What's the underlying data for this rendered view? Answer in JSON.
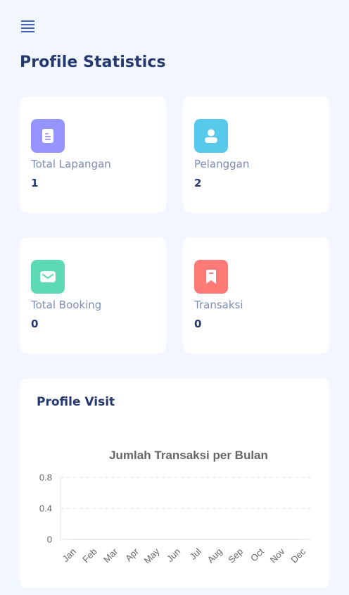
{
  "header": {
    "menu_icon": "hamburger-menu-icon",
    "title": "Profile Statistics"
  },
  "stats": [
    {
      "label": "Total Lapangan",
      "value": "1",
      "icon": "document-icon",
      "color": "#9694ff"
    },
    {
      "label": "Pelanggan",
      "value": "2",
      "icon": "user-icon",
      "color": "#57caeb"
    },
    {
      "label": "Total Booking",
      "value": "0",
      "icon": "envelope-icon",
      "color": "#5ddab4"
    },
    {
      "label": "Transaksi",
      "value": "0",
      "icon": "bookmark-icon",
      "color": "#ff7976"
    }
  ],
  "visit_card": {
    "title": "Profile Visit"
  },
  "chart_data": {
    "type": "line",
    "title": "Jumlah Transaksi per Bulan",
    "categories": [
      "Jan",
      "Feb",
      "Mar",
      "Apr",
      "May",
      "Jun",
      "Jul",
      "Aug",
      "Sep",
      "Oct",
      "Nov",
      "Dec"
    ],
    "series": [
      {
        "values": [
          0,
          0,
          0,
          0,
          0,
          0,
          0,
          0,
          0,
          0,
          0,
          0
        ]
      }
    ],
    "yticks": [
      "0.8",
      "0.4",
      "0"
    ],
    "ylim": [
      0,
      0.8
    ],
    "grid": true
  }
}
